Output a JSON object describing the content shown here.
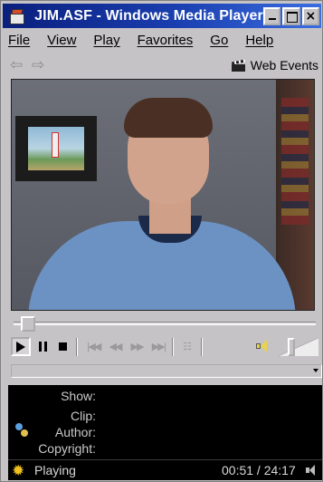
{
  "window": {
    "title": "JIM.ASF - Windows Media Player"
  },
  "caption_buttons": {
    "minimize": "_",
    "maximize": "□",
    "close": "×"
  },
  "menu": {
    "items": [
      "File",
      "View",
      "Play",
      "Favorites",
      "Go",
      "Help"
    ]
  },
  "toolbar": {
    "back_icon": "back-arrow",
    "forward_icon": "forward-arrow",
    "web_events_label": "Web Events"
  },
  "video": {
    "content": "person-in-blue-shirt"
  },
  "seek": {
    "position_fraction": 0.024
  },
  "volume": {
    "level_fraction": 0.28
  },
  "info": {
    "labels": {
      "show": "Show:",
      "clip": "Clip:",
      "author": "Author:",
      "copyright": "Copyright:"
    },
    "values": {
      "show": "",
      "clip": "",
      "author": "",
      "copyright": ""
    }
  },
  "status": {
    "state": "Playing",
    "time": "00:51 / 24:17"
  },
  "colors": {
    "titlebar": "#0a1f7d",
    "chrome": "#c6c3c6",
    "info_panel": "#000000",
    "status_text": "#d8d8d8"
  }
}
